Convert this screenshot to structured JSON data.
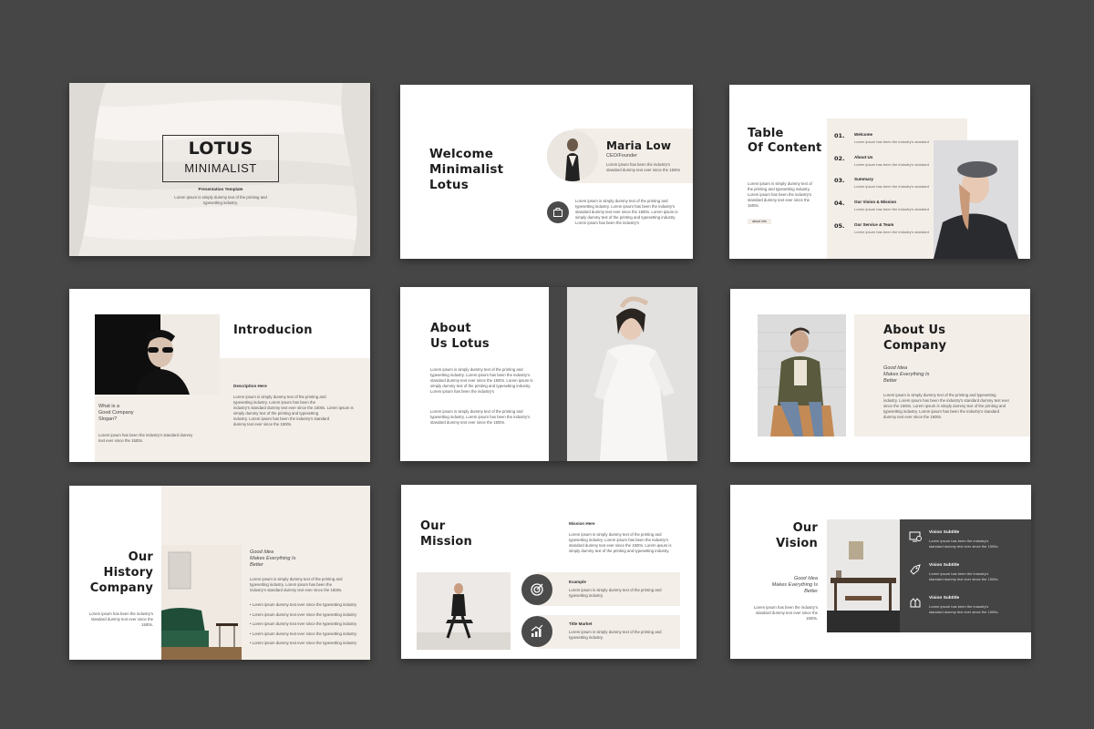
{
  "colors": {
    "background": "#464646",
    "beige": "#f3eee8",
    "dark": "#4b4b4b",
    "vision_panel": "#444444"
  },
  "slide1": {
    "title": "LOTUS",
    "subtitle": "MINIMALIST",
    "tag": "Presentation Template",
    "text1": "Lorem ipsum is simply dummy text of the printing and",
    "text2": "typesetting industry."
  },
  "slide2": {
    "heading1": "Welcome",
    "heading2": "Minimalist",
    "heading3": "Lotus",
    "name": "Maria Low",
    "role": "CEO/Founder",
    "bio1": "Lorem ipsum has been the industry's",
    "bio2": "standard dummy text ever since the 1500s",
    "p1": "Lorem ipsum is simply dummy text of the printing and",
    "p2": "typesetting industry. Lorem ipsum has been the industry's",
    "p3": "standard dummy text ever since the 1500s. Lorem ipsum is",
    "p4": "simply dummy text of the printing and typesetting industry.",
    "p5": "Lorem ipsum has been the industry's"
  },
  "slide3": {
    "heading1": "Table",
    "heading2": "Of Content",
    "text1": "Lorem ipsum is simply dummy text of",
    "text2": "the printing and typesetting industry.",
    "text3": "Lorem ipsum has been the industry's",
    "text4": "standard dummy text ever since the",
    "text5": "1500s.",
    "button": "about info",
    "items": [
      {
        "num": "01.",
        "title": "Welcome",
        "desc": "Lorem ipsum has been the industry's standard"
      },
      {
        "num": "02.",
        "title": "About Us",
        "desc": "Lorem ipsum has been the industry's standard"
      },
      {
        "num": "03.",
        "title": "Summary",
        "desc": "Lorem ipsum has been the industry's standard"
      },
      {
        "num": "04.",
        "title": "Our Vision & Mission",
        "desc": "Lorem ipsum has been the industry's standard"
      },
      {
        "num": "05.",
        "title": "Our Service & Team",
        "desc": "Lorem ipsum has been the industry's standard"
      }
    ]
  },
  "slide4": {
    "heading": "Introducion",
    "question1": "What is a",
    "question2": "Good Company",
    "question3": "Slogan?",
    "q_text1": "Lorem ipsum has been the industry's standard dummy",
    "q_text2": "text ever since the 1500s.",
    "desc_label": "Description Here",
    "d1": "Lorem ipsum is simply dummy text of the printing and",
    "d2": "typesetting industry. Lorem ipsum has been the",
    "d3": "industry's standard dummy text ever since the 1500s. Lorem ipsum is",
    "d4": "simply dummy text of the printing and typesetting",
    "d5": "industry. Lorem ipsum has been the industry's standard",
    "d6": "dummy text ever since the 1500s."
  },
  "slide5": {
    "heading1": "About",
    "heading2": "Us Lotus",
    "p1": "Lorem ipsum is simply dummy text of the printing and",
    "p2": "typesetting industry. Lorem ipsum has been the industry's",
    "p3": "standard dummy text ever since the 1500s. Lorem ipsum is",
    "p4": "simply dummy text of the printing and typesetting industry.",
    "p5": "Lorem ipsum has been the industry's",
    "p6": "Lorem ipsum is simply dummy text of the printing and",
    "p7": "typesetting industry. Lorem ipsum has been the industry's",
    "p8": "standard dummy text ever since the 1500s."
  },
  "slide6": {
    "heading1": "About Us",
    "heading2": "Company",
    "idea1": "Good Idea",
    "idea2": "Makes Everything Is",
    "idea3": "Better",
    "p1": "Lorem ipsum is simply dummy text of the printing and typesetting",
    "p2": "industry. Lorem ipsum has been the industry's standard dummy text ever",
    "p3": "since the 1500s. Lorem ipsum is simply dummy text of the printing and",
    "p4": "typesetting industry. Lorem ipsum has been the industry's standard",
    "p5": "dummy text ever since the 1500s."
  },
  "slide7": {
    "heading1": "Our",
    "heading2": "History",
    "heading3": "Company",
    "left1": "Lorem ipsum has been the industry's",
    "left2": "standard dummy text ever since the",
    "left3": "1500s.",
    "idea1": "Good Idea",
    "idea2": "Makes Everything Is",
    "idea3": "Better",
    "p1": "Lorem ipsum is simply dummy text of the printing and",
    "p2": "typesetting industry. Lorem ipsum has been the",
    "p3": "industry's standard dummy text ever since the 1500s.",
    "bullets": [
      "Lorem ipsum dummy text ever since the typesetting industry",
      "Lorem ipsum dummy text ever since the typesetting industry",
      "Lorem ipsum dummy text ever since the typesetting industry",
      "Lorem ipsum dummy text ever since the typesetting industry",
      "Lorem ipsum dummy text ever since the typesetting industry"
    ]
  },
  "slide8": {
    "heading1": "Our",
    "heading2": "Mission",
    "mission_label": "Mission Here",
    "m1": "Lorem ipsum is simply dummy text of the printing and",
    "m2": "typesetting industry. Lorem ipsum has been the industry's",
    "m3": "standard dummy text ever since the 1500s. Lorem ipsum is",
    "m4": "simply dummy text of the printing and typesetting industry.",
    "example_label": "Example",
    "e1": "Lorem ipsum is simply dummy text of the printing and",
    "e2": "typesetting industry.",
    "title_label": "Title Market",
    "t1": "Lorem ipsum is simply dummy text of the printing and",
    "t2": "typesetting industry."
  },
  "slide9": {
    "heading1": "Our",
    "heading2": "Vision",
    "idea1": "Good Idea",
    "idea2": "Makes Everything Is",
    "idea3": "Better",
    "l1": "Lorem ipsum has been the industry's",
    "l2": "standard dummy text ever since the",
    "l3": "1500s.",
    "items": [
      {
        "title": "Vision Subtitle",
        "d1": "Lorem ipsum has been the industry's",
        "d2": "standard dummy text ever since the 1500s."
      },
      {
        "title": "Vision Subtitle",
        "d1": "Lorem ipsum has been the industry's",
        "d2": "standard dummy text ever since the 1500s."
      },
      {
        "title": "Vision Subtitle",
        "d1": "Lorem ipsum has been the industry's",
        "d2": "standard dummy text ever since the 1500s."
      }
    ]
  }
}
